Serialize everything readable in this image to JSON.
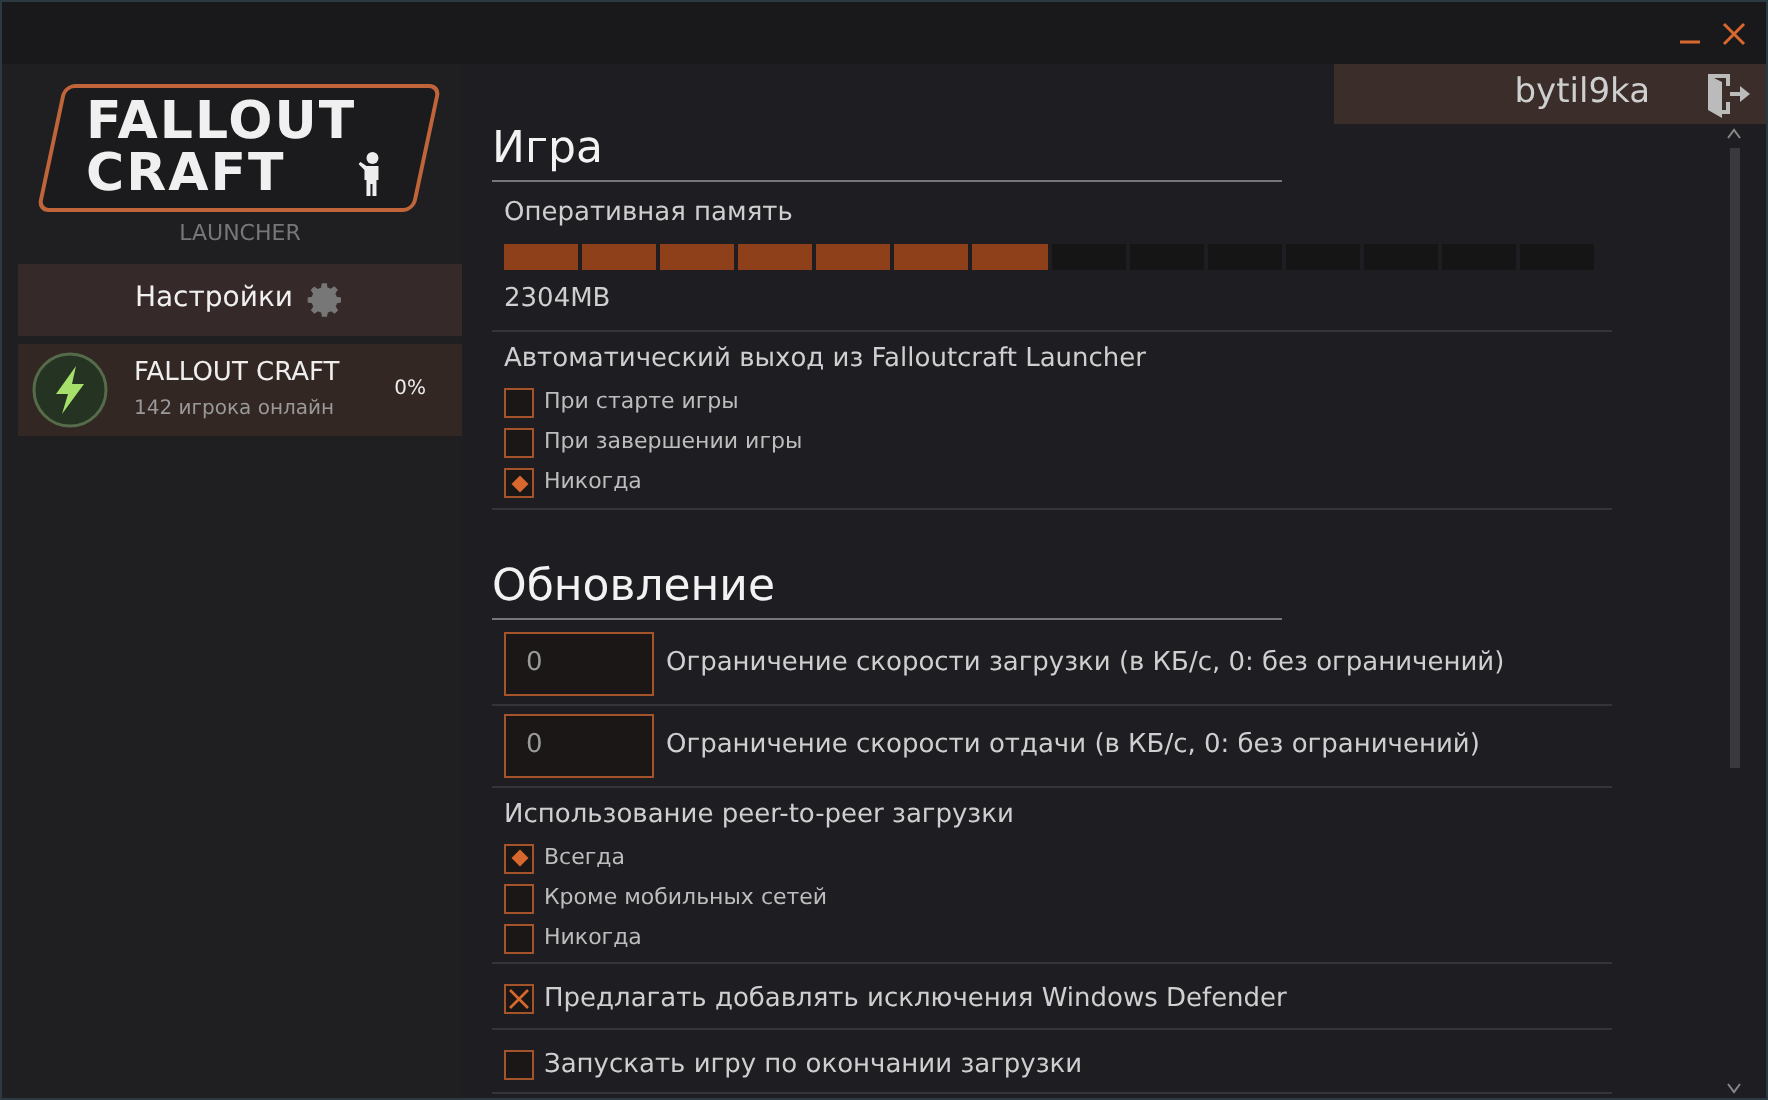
{
  "logo": {
    "line_1": "FALLOUT",
    "line_2": "CRAFT",
    "subtitle": "LAUNCHER"
  },
  "settings_button": {
    "label": "Настройки"
  },
  "servers": [
    {
      "name": "FALLOUT CRAFT",
      "online": "142 игрока онлайн",
      "progress": "0%",
      "selected": true
    }
  ],
  "user": {
    "name": "bytil9ka"
  },
  "sections": [
    {
      "title": "Игра",
      "items": [
        {
          "kind": "memory",
          "label": "Оперативная память",
          "level": 0.5,
          "value": "2304MB"
        },
        {
          "kind": "radio_group",
          "label": "Автоматический выход из Falloutcraft Launcher",
          "options": [
            {
              "label": "При старте игры",
              "selected": false
            },
            {
              "label": "При завершении игры",
              "selected": false
            },
            {
              "label": "Никогда",
              "selected": true
            }
          ]
        }
      ]
    },
    {
      "title": "Обновление",
      "items": [
        {
          "kind": "number",
          "field": {
            "value": "0",
            "caption": "Ограничение скорости загрузки (в КБ/с, 0: без ограничений)"
          }
        },
        {
          "kind": "number",
          "field": {
            "value": "0",
            "caption": "Ограничение скорости отдачи (в КБ/с, 0: без ограничений)"
          }
        },
        {
          "kind": "radio_group",
          "label": "Использование peer-to-peer загрузки",
          "options": [
            {
              "label": "Всегда",
              "selected": true
            },
            {
              "label": "Кроме мобильных сетей",
              "selected": false
            },
            {
              "label": "Никогда",
              "selected": false
            }
          ]
        },
        {
          "kind": "checkbox",
          "label": "Предлагать добавлять исключения Windows Defender",
          "checked": true
        },
        {
          "kind": "checkbox",
          "label": "Запускать игру по окончании загрузки",
          "checked": false
        }
      ]
    }
  ]
}
